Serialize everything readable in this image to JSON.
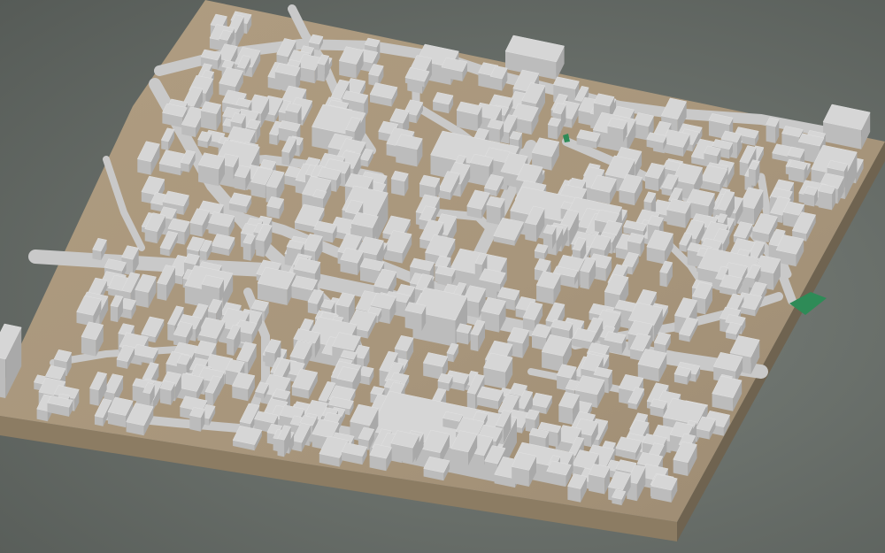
{
  "viewport": {
    "kind": "3d-city-model",
    "background_color": "#6b716c"
  },
  "scene": {
    "base_top_color": "#a8967c",
    "base_side_front_color": "#8c7c63",
    "base_side_right_color": "#6f6350",
    "road_color": "#c9c9c9",
    "building_top_color": "#d6d6d6",
    "building_side_color": "#bcbcbc",
    "green_patch_color": "#2e8b57"
  }
}
